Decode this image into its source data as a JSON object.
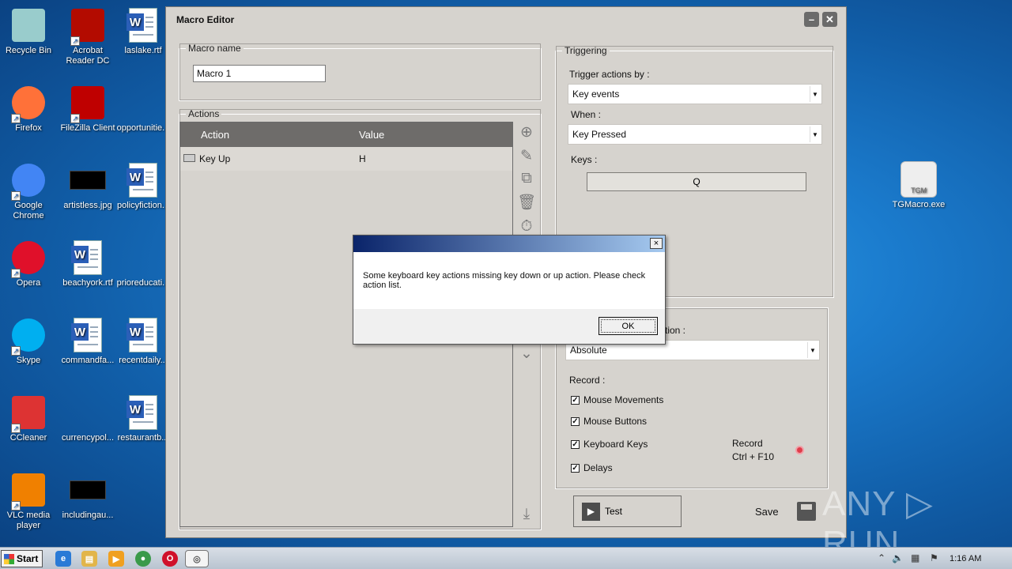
{
  "desktop": {
    "icons_left": [
      {
        "label": "Recycle Bin",
        "icon": "recycle-bin-icon"
      },
      {
        "label": "Acrobat Reader DC",
        "icon": "acrobat-icon"
      },
      {
        "label": "laslake.rtf",
        "icon": "word-doc-icon"
      },
      {
        "label": "Firefox",
        "icon": "firefox-icon"
      },
      {
        "label": "FileZilla Client",
        "icon": "filezilla-icon"
      },
      {
        "label": "opportunitie...",
        "icon": "blank-file-icon"
      },
      {
        "label": "Google Chrome",
        "icon": "chrome-icon"
      },
      {
        "label": "artistless.jpg",
        "icon": "image-file-icon"
      },
      {
        "label": "policyfiction...",
        "icon": "word-doc-icon"
      },
      {
        "label": "Opera",
        "icon": "opera-icon"
      },
      {
        "label": "beachyork.rtf",
        "icon": "word-doc-icon"
      },
      {
        "label": "prioreducati...",
        "icon": "blank-file-icon"
      },
      {
        "label": "Skype",
        "icon": "skype-icon"
      },
      {
        "label": "commandfa...",
        "icon": "word-doc-icon"
      },
      {
        "label": "recentdaily...",
        "icon": "word-doc-icon"
      },
      {
        "label": "CCleaner",
        "icon": "ccleaner-icon"
      },
      {
        "label": "currencypol...",
        "icon": "blank-file-icon"
      },
      {
        "label": "restaurantb...",
        "icon": "word-doc-icon"
      },
      {
        "label": "VLC media player",
        "icon": "vlc-icon"
      },
      {
        "label": "includingau...",
        "icon": "image-file-icon"
      }
    ],
    "tgmacro": {
      "label": "TGMacro.exe",
      "badge": "TGM"
    }
  },
  "window": {
    "title": "Macro Editor",
    "macro_name": {
      "legend": "Macro name",
      "value": "Macro 1"
    },
    "actions": {
      "legend": "Actions",
      "columns": [
        "Action",
        "Value"
      ],
      "rows": [
        {
          "action": "Key Up",
          "value": "H"
        }
      ]
    },
    "triggering": {
      "legend": "Triggering",
      "trigger_label": "Trigger actions by :",
      "trigger_value": "Key events",
      "when_label": "When :",
      "when_value": "Key Pressed",
      "keys_label": "Keys :",
      "keys_value": "Q"
    },
    "recording": {
      "position_label_partial": "tion :",
      "position_value": "Absolute",
      "record_label": "Record :",
      "options": [
        {
          "label": "Mouse Movements",
          "checked": true
        },
        {
          "label": "Mouse Buttons",
          "checked": true
        },
        {
          "label": "Keyboard Keys",
          "checked": true
        },
        {
          "label": "Delays",
          "checked": true
        }
      ],
      "hotkey_line1": "Record",
      "hotkey_line2": "Ctrl + F10"
    },
    "test_label": "Test",
    "save_label": "Save"
  },
  "dialog": {
    "message": "Some keyboard key actions missing key down or up action. Please check action list.",
    "ok_label": "OK",
    "close_glyph": "×"
  },
  "watermark": "ANY ▷ RUN",
  "taskbar": {
    "start_label": "Start",
    "clock": "1:16 AM"
  },
  "colors": {
    "accent_red": "#e03c4a",
    "dialog_title_left": "#0a246a",
    "dialog_title_right": "#a6caf0"
  }
}
